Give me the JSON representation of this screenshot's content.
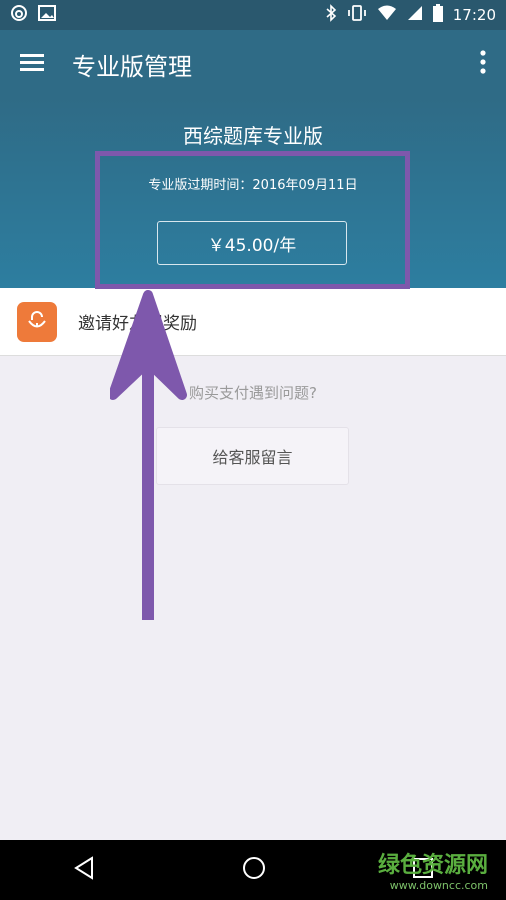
{
  "status": {
    "time": "17:20"
  },
  "appbar": {
    "title": "专业版管理"
  },
  "header": {
    "product": "西综题库专业版",
    "expire_text": "专业版过期时间：2016年09月11日",
    "price": "￥45.00/年"
  },
  "invite": {
    "label": "邀请好友得奖励"
  },
  "help": {
    "text": "购买支付遇到问题?",
    "button": "给客服留言"
  },
  "watermark": {
    "name": "绿色资源网",
    "url": "www.downcc.com"
  },
  "colors": {
    "accent": "#2f6b86",
    "highlight": "#7e58ac",
    "invite": "#ee7a3a"
  }
}
